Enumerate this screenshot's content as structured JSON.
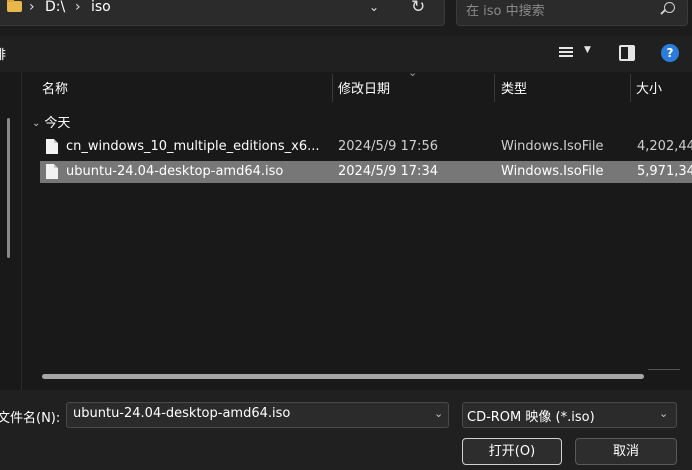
{
  "address_bar": {
    "crumbs": [
      "D:\\",
      "iso"
    ],
    "separator": "›",
    "chevron": "⌄",
    "refresh": "↻"
  },
  "search": {
    "placeholder": "在 iso 中搜索"
  },
  "toolbar": {
    "left_label": "排",
    "help": "?"
  },
  "columns": {
    "name": "名称",
    "date": "修改日期",
    "type": "类型",
    "size": "大小",
    "sort_indicator": "⌄"
  },
  "group": {
    "label": "今天",
    "chevron": "⌄"
  },
  "files": [
    {
      "name": "cn_windows_10_multiple_editions_x6...",
      "date": "2024/5/9 17:56",
      "type": "Windows.IsoFile",
      "size": "4,202,44",
      "selected": false
    },
    {
      "name": "ubuntu-24.04-desktop-amd64.iso",
      "date": "2024/5/9 17:34",
      "type": "Windows.IsoFile",
      "size": "5,971,34",
      "selected": true
    }
  ],
  "bottom": {
    "filename_label": "文件名(N):",
    "filename_value": "ubuntu-24.04-desktop-amd64.iso",
    "filter_value": "CD-ROM 映像 (*.iso)",
    "dropdown_chevron": "⌄",
    "open_label": "打开(O)",
    "cancel_label": "取消"
  },
  "colors": {
    "background": "#191919",
    "selected_row": "#777777",
    "folder": "#e8b94a",
    "help_accent": "#2b7ddb"
  }
}
